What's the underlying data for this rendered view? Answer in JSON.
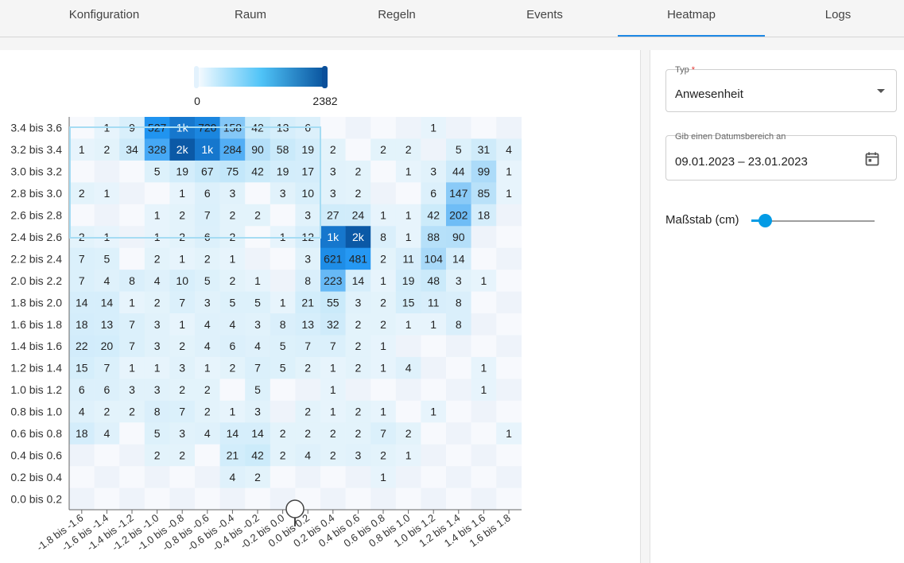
{
  "tabs": [
    {
      "label": "Konfiguration",
      "active": false
    },
    {
      "label": "Raum",
      "active": false
    },
    {
      "label": "Regeln",
      "active": false
    },
    {
      "label": "Events",
      "active": false
    },
    {
      "label": "Heatmap",
      "active": true
    },
    {
      "label": "Logs",
      "active": false
    }
  ],
  "form": {
    "type_label": "Typ",
    "type_required": "*",
    "type_value": "Anwesenheit",
    "date_label": "Gib einen Datumsbereich an",
    "date_value": "09.01.2023 – 23.01.2023",
    "scale_label": "Maßstab (cm)",
    "scale_value": 0.07
  },
  "colors": {
    "accent": "#1e88e5",
    "slider": "#039be5",
    "cell_low": "#f7fbff",
    "cell_high": "#08519c"
  },
  "chart_data": {
    "type": "heatmap",
    "legend": {
      "min_label": "0",
      "max_label": "2382",
      "min": 0,
      "max": 2382
    },
    "x_labels": [
      "-1.8 bis -1.6",
      "-1.6 bis -1.4",
      "-1.4 bis -1.2",
      "-1.2 bis -1.0",
      "-1.0 bis -0.8",
      "-0.8 bis -0.6",
      "-0.6 bis -0.4",
      "-0.4 bis -0.2",
      "-0.2 bis 0.0",
      "0.0 bis 0.2",
      "0.2 bis 0.4",
      "0.4 bis 0.6",
      "0.6 bis 0.8",
      "0.8 bis 1.0",
      "1.0 bis 1.2",
      "1.2 bis 1.4",
      "1.4 bis 1.6",
      "1.6 bis 1.8"
    ],
    "y_labels": [
      "3.4 bis 3.6",
      "3.2 bis 3.4",
      "3.0 bis 3.2",
      "2.8 bis 3.0",
      "2.6 bis 2.8",
      "2.4 bis 2.6",
      "2.2 bis 2.4",
      "2.0 bis 2.2",
      "1.8 bis 2.0",
      "1.6 bis 1.8",
      "1.4 bis 1.6",
      "1.2 bis 1.4",
      "1.0 bis 1.2",
      "0.8 bis 1.0",
      "0.6 bis 0.8",
      "0.4 bis 0.6",
      "0.2 bis 0.4",
      "0.0 bis 0.2"
    ],
    "values": [
      [
        0,
        1,
        9,
        527,
        1000,
        720,
        158,
        42,
        13,
        6,
        0,
        0,
        0,
        0,
        1,
        0,
        0,
        0
      ],
      [
        1,
        2,
        34,
        328,
        2000,
        1000,
        284,
        90,
        58,
        19,
        2,
        0,
        2,
        2,
        0,
        5,
        31,
        4
      ],
      [
        0,
        0,
        0,
        5,
        19,
        67,
        75,
        42,
        19,
        17,
        3,
        2,
        0,
        1,
        3,
        44,
        99,
        1
      ],
      [
        2,
        1,
        0,
        0,
        1,
        6,
        3,
        0,
        3,
        10,
        3,
        2,
        0,
        0,
        6,
        147,
        85,
        1
      ],
      [
        0,
        0,
        0,
        1,
        2,
        7,
        2,
        2,
        0,
        3,
        27,
        24,
        1,
        1,
        42,
        202,
        18,
        0
      ],
      [
        2,
        1,
        0,
        1,
        2,
        6,
        2,
        0,
        1,
        12,
        1000,
        2000,
        8,
        1,
        88,
        90,
        0,
        0
      ],
      [
        7,
        5,
        0,
        2,
        1,
        2,
        1,
        0,
        0,
        3,
        621,
        481,
        2,
        11,
        104,
        14,
        0,
        0
      ],
      [
        7,
        4,
        8,
        4,
        10,
        5,
        2,
        1,
        0,
        8,
        223,
        14,
        1,
        19,
        48,
        3,
        1,
        0
      ],
      [
        14,
        14,
        1,
        2,
        7,
        3,
        5,
        5,
        1,
        21,
        55,
        3,
        2,
        15,
        11,
        8,
        0,
        0
      ],
      [
        18,
        13,
        7,
        3,
        1,
        4,
        4,
        3,
        8,
        13,
        32,
        2,
        2,
        1,
        1,
        8,
        0,
        0
      ],
      [
        22,
        20,
        7,
        3,
        2,
        4,
        6,
        4,
        5,
        7,
        7,
        2,
        1,
        0,
        0,
        0,
        0,
        0
      ],
      [
        15,
        7,
        1,
        1,
        3,
        1,
        2,
        7,
        5,
        2,
        1,
        2,
        1,
        4,
        0,
        0,
        1,
        0
      ],
      [
        6,
        6,
        3,
        3,
        2,
        2,
        0,
        5,
        0,
        0,
        1,
        0,
        0,
        0,
        0,
        0,
        1,
        0
      ],
      [
        4,
        2,
        2,
        8,
        7,
        2,
        1,
        3,
        0,
        2,
        1,
        2,
        1,
        0,
        1,
        0,
        0,
        0
      ],
      [
        18,
        4,
        0,
        5,
        3,
        4,
        14,
        14,
        2,
        2,
        2,
        2,
        7,
        2,
        0,
        0,
        0,
        1
      ],
      [
        0,
        0,
        0,
        2,
        2,
        0,
        21,
        42,
        2,
        4,
        2,
        3,
        2,
        1,
        0,
        0,
        0,
        0
      ],
      [
        0,
        0,
        0,
        0,
        0,
        0,
        4,
        2,
        0,
        0,
        0,
        0,
        1,
        0,
        0,
        0,
        0,
        0
      ],
      [
        0,
        0,
        0,
        0,
        0,
        0,
        0,
        0,
        0,
        0,
        0,
        0,
        0,
        0,
        0,
        0,
        0,
        0
      ]
    ],
    "labels": [
      [
        "",
        "1",
        "9",
        "527",
        "1k",
        "720",
        "158",
        "42",
        "13",
        "6",
        "",
        "",
        "",
        "",
        "1",
        "",
        "",
        ""
      ],
      [
        "1",
        "2",
        "34",
        "328",
        "2k",
        "1k",
        "284",
        "90",
        "58",
        "19",
        "2",
        "",
        "2",
        "2",
        "",
        "5",
        "31",
        "4"
      ],
      [
        "",
        "",
        "",
        "5",
        "19",
        "67",
        "75",
        "42",
        "19",
        "17",
        "3",
        "2",
        "",
        "1",
        "3",
        "44",
        "99",
        "1"
      ],
      [
        "2",
        "1",
        "",
        "",
        "1",
        "6",
        "3",
        "",
        "3",
        "10",
        "3",
        "2",
        "",
        "",
        "6",
        "147",
        "85",
        "1"
      ],
      [
        "",
        "",
        "",
        "1",
        "2",
        "7",
        "2",
        "2",
        "",
        "3",
        "27",
        "24",
        "1",
        "1",
        "42",
        "202",
        "18",
        ""
      ],
      [
        "2",
        "1",
        "",
        "1",
        "2",
        "6",
        "2",
        "",
        "1",
        "12",
        "1k",
        "2k",
        "8",
        "1",
        "88",
        "90",
        "",
        ""
      ],
      [
        "7",
        "5",
        "",
        "2",
        "1",
        "2",
        "1",
        "",
        "",
        "3",
        "621",
        "481",
        "2",
        "11",
        "104",
        "14",
        "",
        ""
      ],
      [
        "7",
        "4",
        "8",
        "4",
        "10",
        "5",
        "2",
        "1",
        "",
        "8",
        "223",
        "14",
        "1",
        "19",
        "48",
        "3",
        "1",
        ""
      ],
      [
        "14",
        "14",
        "1",
        "2",
        "7",
        "3",
        "5",
        "5",
        "1",
        "21",
        "55",
        "3",
        "2",
        "15",
        "11",
        "8",
        "",
        ""
      ],
      [
        "18",
        "13",
        "7",
        "3",
        "1",
        "4",
        "4",
        "3",
        "8",
        "13",
        "32",
        "2",
        "2",
        "1",
        "1",
        "8",
        "",
        ""
      ],
      [
        "22",
        "20",
        "7",
        "3",
        "2",
        "4",
        "6",
        "4",
        "5",
        "7",
        "7",
        "2",
        "1",
        "",
        "",
        "",
        "",
        ""
      ],
      [
        "15",
        "7",
        "1",
        "1",
        "3",
        "1",
        "2",
        "7",
        "5",
        "2",
        "1",
        "2",
        "1",
        "4",
        "",
        "",
        "1",
        ""
      ],
      [
        "6",
        "6",
        "3",
        "3",
        "2",
        "2",
        "",
        "5",
        "",
        "",
        "1",
        "",
        "",
        "",
        "",
        "",
        "1",
        ""
      ],
      [
        "4",
        "2",
        "2",
        "8",
        "7",
        "2",
        "1",
        "3",
        "",
        "2",
        "1",
        "2",
        "1",
        "",
        "1",
        "",
        "",
        ""
      ],
      [
        "18",
        "4",
        "",
        "5",
        "3",
        "4",
        "14",
        "14",
        "2",
        "2",
        "2",
        "2",
        "7",
        "2",
        "",
        "",
        "",
        "1"
      ],
      [
        "",
        "",
        "",
        "2",
        "2",
        "",
        "21",
        "42",
        "2",
        "4",
        "2",
        "3",
        "2",
        "1",
        "",
        "",
        "",
        ""
      ],
      [
        "",
        "",
        "",
        "",
        "",
        "",
        "4",
        "2",
        "",
        "",
        "",
        "",
        "1",
        "",
        "",
        "",
        "",
        ""
      ],
      [
        "",
        "",
        "",
        "",
        "",
        "",
        "",
        "",
        "",
        "",
        "",
        "",
        "",
        "",
        "",
        "",
        "",
        ""
      ]
    ]
  }
}
